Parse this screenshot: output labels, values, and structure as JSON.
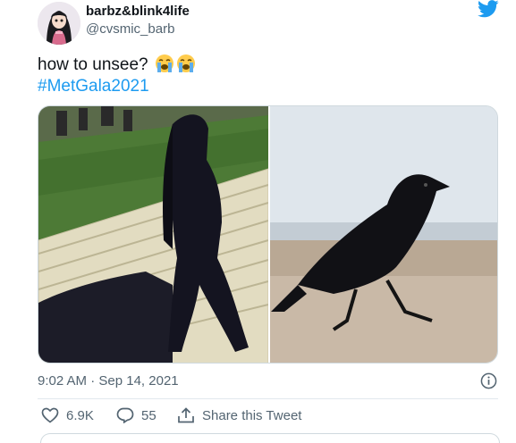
{
  "user": {
    "display_name": "barbz&blink4life",
    "handle": "@cvsmic_barb"
  },
  "tweet": {
    "text": "how to unsee?",
    "emoji": "loudly-crying-face",
    "hashtag": "#MetGala2021",
    "time": "9:02 AM",
    "separator": "·",
    "date": "Sep 14, 2021"
  },
  "actions": {
    "likes": "6.9K",
    "replies": "55",
    "share_label": "Share this Tweet"
  },
  "colors": {
    "brand": "#1d9bf0",
    "text": "#0f1419",
    "secondary": "#536471"
  },
  "icons": [
    "twitter-bird-icon",
    "heart-icon",
    "reply-icon",
    "share-icon",
    "info-icon"
  ]
}
